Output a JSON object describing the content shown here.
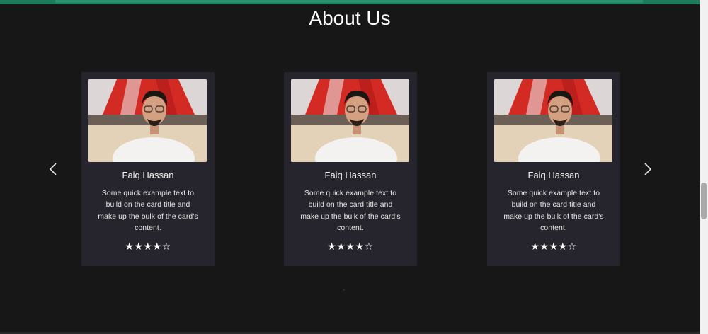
{
  "page": {
    "title": "About Us"
  },
  "colors": {
    "background": "#181717",
    "card": "#26252d",
    "accent_bar": "#1d7a5a"
  },
  "carousel": {
    "prev_icon": "chevron-left-icon",
    "next_icon": "chevron-right-icon",
    "cards": [
      {
        "name": "Faiq Hassan",
        "text": "Some quick example text to build on the card title and make up the bulk of the card's content.",
        "rating": "★★★★☆",
        "rating_value": 4,
        "rating_max": 5
      },
      {
        "name": "Faiq Hassan",
        "text": "Some quick example text to build on the card title and make up the bulk of the card's content.",
        "rating": "★★★★☆",
        "rating_value": 4,
        "rating_max": 5
      },
      {
        "name": "Faiq Hassan",
        "text": "Some quick example text to build on the card title and make up the bulk of the card's content.",
        "rating": "★★★★☆",
        "rating_value": 4,
        "rating_max": 5
      }
    ]
  }
}
